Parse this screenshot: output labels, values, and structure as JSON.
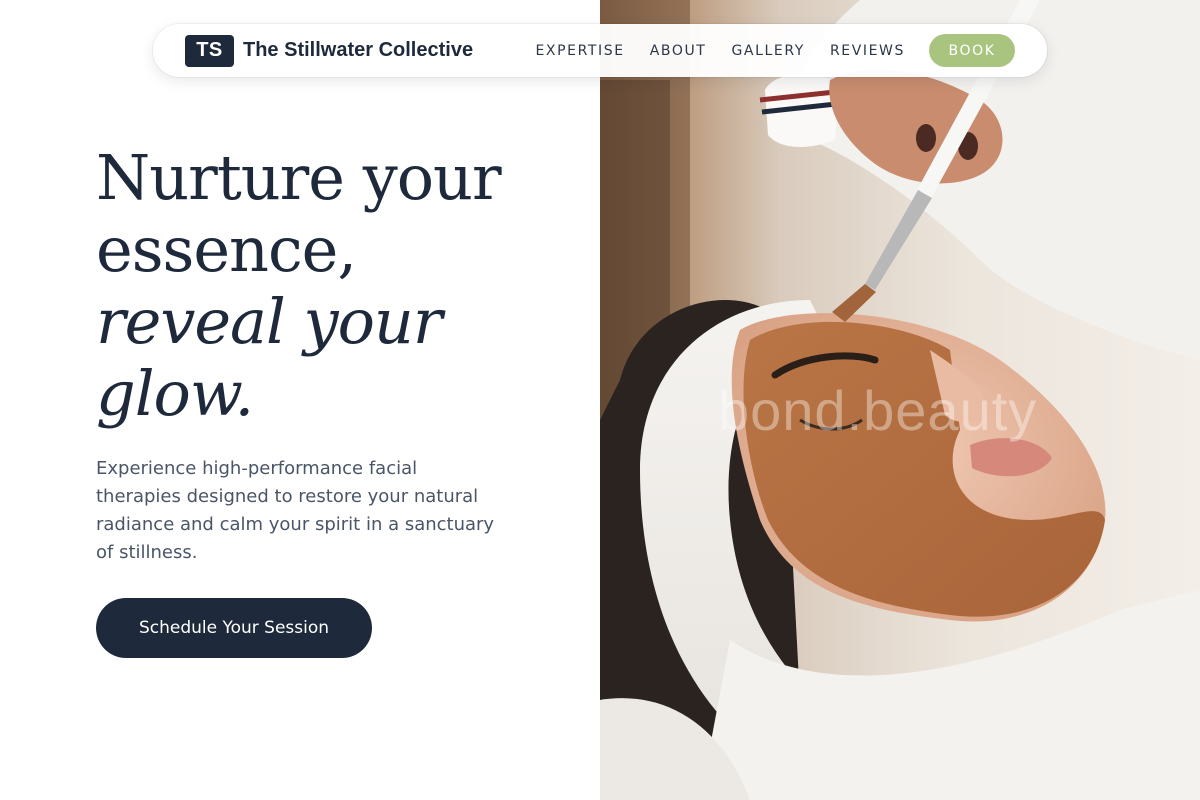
{
  "brand": {
    "initials": "TS",
    "name": "The Stillwater Collective"
  },
  "nav": {
    "links": [
      "EXPERTISE",
      "ABOUT",
      "GALLERY",
      "REVIEWS"
    ],
    "book_label": "BOOK"
  },
  "hero": {
    "headline_line1": "Nurture your",
    "headline_line2": "essence,",
    "headline_line3": "reveal your",
    "headline_line4": "glow.",
    "lead": "Experience high-performance facial therapies designed to restore your natural radiance and calm your spirit in a sanctuary of stillness.",
    "cta_label": "Schedule Your Session",
    "photo_watermark": "bond.beauty"
  },
  "colors": {
    "navy": "#1e2a3b",
    "accent_green": "#a9c47f",
    "body_text": "#4a5568",
    "background": "#ffffff"
  },
  "icons": [
    "logo-badge"
  ]
}
